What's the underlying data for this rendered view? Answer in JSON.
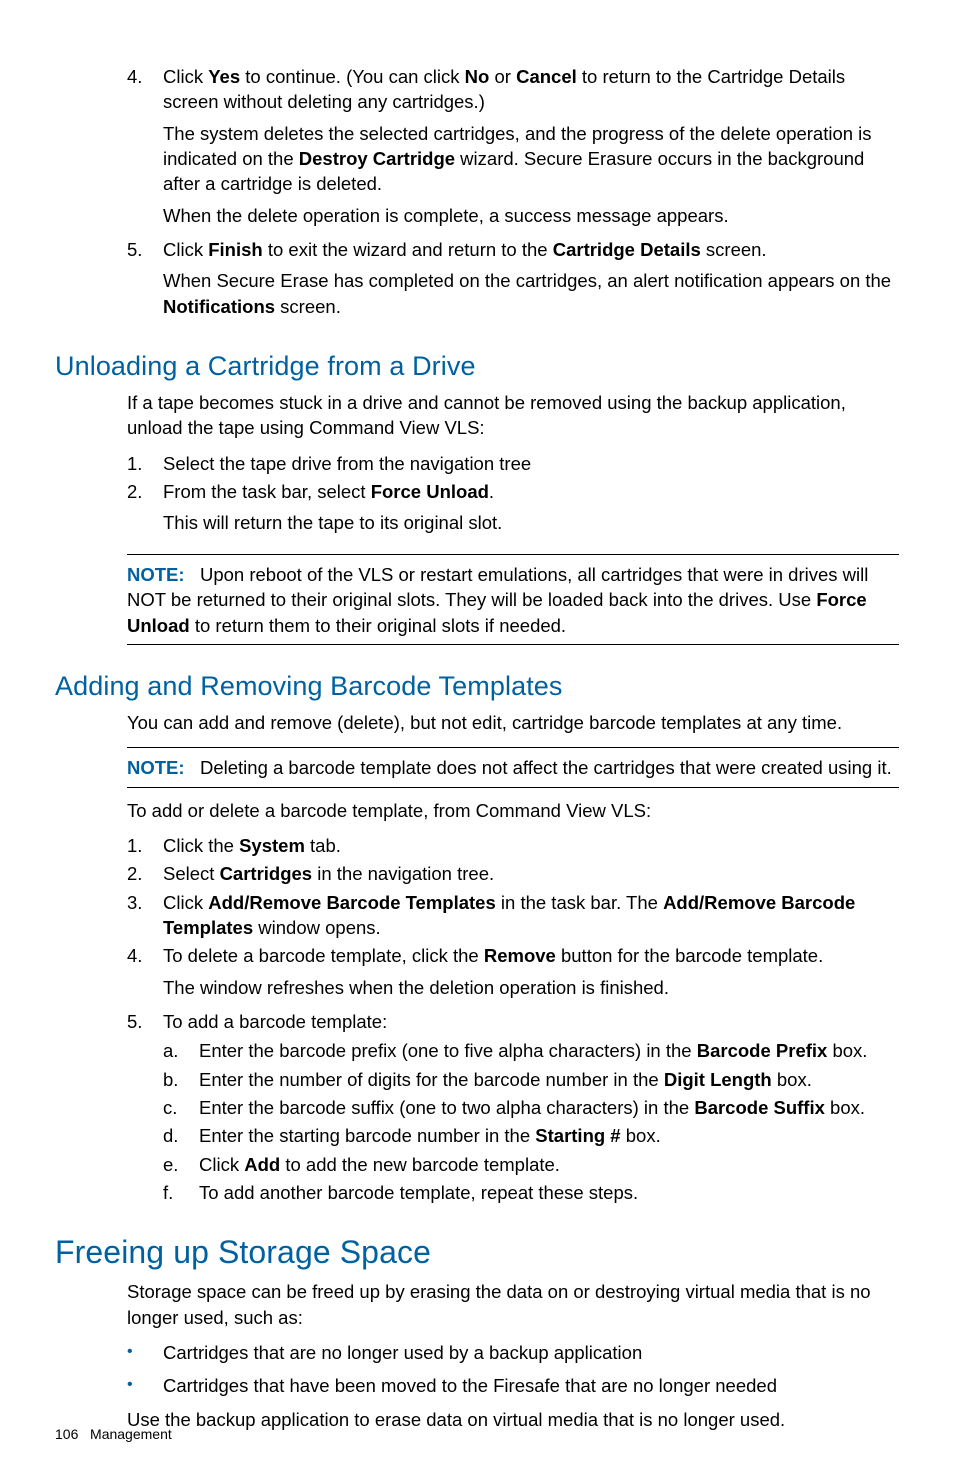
{
  "steps_top": [
    {
      "n": "4.",
      "text": "Click <b>Yes</b> to continue. (You can click <b>No</b> or <b>Cancel</b> to return to the Cartridge Details screen without deleting any cartridges.)",
      "paras": [
        "The system deletes the selected cartridges, and the progress of the delete operation is indicated on the <b>Destroy Cartridge</b> wizard. Secure Erasure occurs in the background after a cartridge is deleted.",
        "When the delete operation is complete, a success message appears."
      ]
    },
    {
      "n": "5.",
      "text": "Click <b>Finish</b> to exit the wizard and return to the <b>Cartridge Details</b> screen.",
      "paras": [
        "When Secure Erase has completed on the cartridges, an alert notification appears on the <b>Notifications</b> screen."
      ]
    }
  ],
  "sec1": {
    "title": "Unloading a Cartridge from a Drive",
    "intro": "If a tape becomes stuck in a drive and cannot be removed using the backup application, unload the tape using Command View VLS:",
    "steps": [
      {
        "n": "1.",
        "text": "Select the tape drive from the navigation tree"
      },
      {
        "n": "2.",
        "text": "From the task bar, select <b>Force Unload</b>.",
        "paras": [
          "This will return the tape to its original slot."
        ]
      }
    ],
    "note": "<span class=\"note-lbl\">NOTE:</span>&nbsp;&nbsp;&nbsp;Upon reboot of the VLS or restart emulations, all cartridges that were in drives will NOT be returned to their original slots. They will be loaded back into the drives. Use <b>Force Unload</b> to return them to their original slots if needed."
  },
  "sec2": {
    "title": "Adding and Removing Barcode Templates",
    "intro": "You can add and remove (delete), but not edit, cartridge barcode templates at any time.",
    "note": "<span class=\"note-lbl\">NOTE:</span>&nbsp;&nbsp;&nbsp;Deleting a barcode template does not affect the cartridges that were created using it.",
    "lead": "To add or delete a barcode template, from Command View VLS:",
    "steps": [
      {
        "n": "1.",
        "text": "Click the <b>System</b> tab."
      },
      {
        "n": "2.",
        "text": "Select <b>Cartridges</b> in the navigation tree."
      },
      {
        "n": "3.",
        "text": "Click <b>Add/Remove Barcode Templates</b> in the task bar. The <b>Add/Remove Barcode Templates</b> window opens."
      },
      {
        "n": "4.",
        "text": "To delete a barcode template, click the <b>Remove</b> button for the barcode template.",
        "paras": [
          "The window refreshes when the deletion operation is finished."
        ]
      },
      {
        "n": "5.",
        "text": "To add a barcode template:",
        "substeps": [
          {
            "n": "a.",
            "text": "Enter the barcode prefix (one to five alpha characters) in the <b>Barcode Prefix</b> box."
          },
          {
            "n": "b.",
            "text": "Enter the number of digits for the barcode number in the <b>Digit Length</b> box."
          },
          {
            "n": "c.",
            "text": "Enter the barcode suffix (one to two alpha characters) in the <b>Barcode Suffix</b> box."
          },
          {
            "n": "d.",
            "text": "Enter the starting barcode number in the <b>Starting #</b>  box."
          },
          {
            "n": "e.",
            "text": "Click <b>Add</b> to add the new barcode template."
          },
          {
            "n": "f.",
            "text": "To add another barcode template, repeat these steps."
          }
        ]
      }
    ]
  },
  "sec3": {
    "title": "Freeing up Storage Space",
    "intro": "Storage space can be freed up by erasing the data on or destroying virtual media that is no longer used, such as:",
    "bullets": [
      "Cartridges that are no longer used by a backup application",
      "Cartridges that have been moved to the Firesafe that are no longer needed"
    ],
    "outro": "Use the backup application to erase data on virtual media that is no longer used."
  },
  "footer": {
    "page": "106",
    "section": "Management"
  }
}
